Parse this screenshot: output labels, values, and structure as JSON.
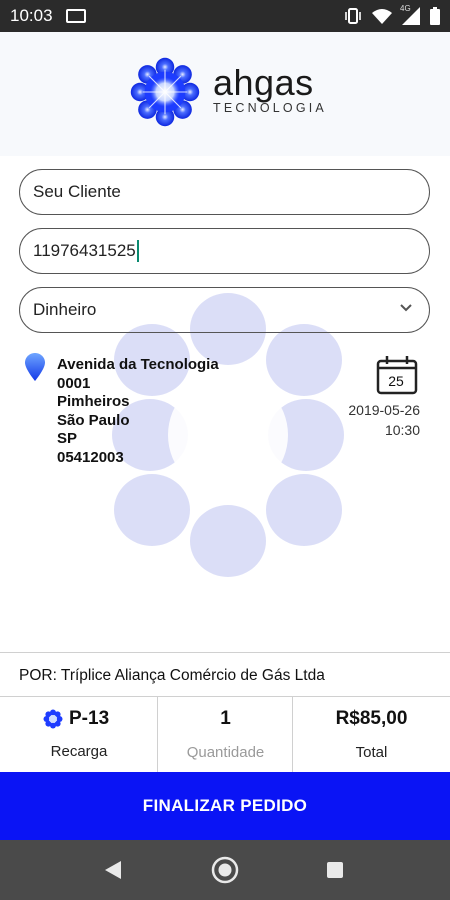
{
  "status_bar": {
    "time": "10:03",
    "network": "4G"
  },
  "header": {
    "brand_name": "ahgas",
    "brand_tagline": "TECNOLOGIA"
  },
  "form": {
    "client_value": "Seu Cliente",
    "phone_value": "11976431525",
    "payment_value": "Dinheiro"
  },
  "address": {
    "street": "Avenida da Tecnologia",
    "number": "0001",
    "district": "Pimheiros",
    "city": "São Paulo",
    "state": "SP",
    "zip": "05412003"
  },
  "schedule": {
    "calendar_day": "25",
    "date": "2019-05-26",
    "time": "10:30"
  },
  "supplier": {
    "text": "POR: Tríplice Aliança Comércio de Gás Ltda"
  },
  "order": {
    "product": "P-13",
    "product_label": "Recarga",
    "quantity": "1",
    "quantity_label": "Quantidade",
    "total": "R$85,00",
    "total_label": "Total"
  },
  "actions": {
    "finalize_label": "FINALIZAR PEDIDO"
  },
  "colors": {
    "primary_button": "#0a14f5",
    "brand_blue": "#1e3cff",
    "caret": "#0a8a70"
  },
  "icons": [
    "vibrate-icon",
    "wifi-icon",
    "signal-icon",
    "battery-icon",
    "location-pin-icon",
    "calendar-icon",
    "chevron-down-icon",
    "back-icon",
    "home-icon",
    "recents-icon"
  ]
}
